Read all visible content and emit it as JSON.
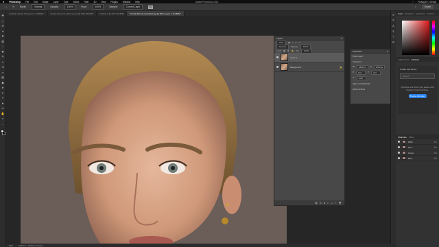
{
  "menubar": {
    "apple": "",
    "app_name": "Photoshop",
    "items": [
      "File",
      "Edit",
      "Image",
      "Layer",
      "Type",
      "Select",
      "Filter",
      "3D",
      "View",
      "Plugins",
      "Window",
      "Help"
    ],
    "window_title": "Adobe Photoshop 2022",
    "clock": "Fri Aug 19 7:19 AM"
  },
  "options": {
    "mode_label": "Mode:",
    "mode_value": "Normal",
    "opacity_label": "Opacity:",
    "opacity_value": "100%",
    "flow_label": "Flow:",
    "flow_value": "100%",
    "sample_label": "Sample:",
    "sample_value": "Current Layer",
    "share_label": "Share"
  },
  "tabs": [
    {
      "label": "Untitled-1 @ 66.7% (Layer 1, RGB/8) *",
      "active": false
    },
    {
      "label": "Model_Retouch_2022_v4.psd @ 50% (RGB/8)",
      "active": false
    },
    {
      "label": "Untitled-2 @ 25% (RGB/8)",
      "active": false
    },
    {
      "label": "Portrait-Blonde-Headshot.jpg @ 50% (Layer 1, RGB/8) *",
      "active": true
    }
  ],
  "tools": [
    "move",
    "marquee",
    "lasso",
    "magic-wand",
    "crop",
    "frame",
    "eyedropper",
    "healing",
    "brush",
    "clone-stamp",
    "history-brush",
    "eraser",
    "gradient",
    "blur",
    "dodge",
    "pen",
    "type",
    "path-select",
    "rectangle",
    "hand",
    "zoom",
    "more"
  ],
  "layers": {
    "title": "Layers",
    "kind_label": "Kind",
    "blend_value": "Normal",
    "opacity_label": "Opacity:",
    "opacity_value": "100%",
    "lock_label": "Lock:",
    "fill_label": "Fill:",
    "fill_value": "100%",
    "rows": [
      {
        "name": "Layer 1",
        "selected": true
      },
      {
        "name": "Background",
        "selected": false
      }
    ]
  },
  "properties": {
    "title": "Properties",
    "subtitle": "Pixel Layer",
    "transform_label": "Transform",
    "w_label": "W",
    "w_value": "1820 px",
    "h_label": "H",
    "h_value": "2730 px",
    "x_label": "X",
    "x_value": "0 px",
    "y_label": "Y",
    "y_value": "0 px",
    "angle_value": "0.00°",
    "align_label": "Align and Distribute",
    "quick_label": "Quick Actions"
  },
  "dock": {
    "tabs": [
      "Color",
      "Swatches",
      "Gradients",
      "Patterns"
    ],
    "adj_tabs": [
      "Adjustments",
      "Libraries"
    ],
    "create_label": "Create new library",
    "search_placeholder": "Search",
    "message": "Organize and share your assets with Creative Cloud Libraries.",
    "browse_label": "Browse Libraries",
    "channels_title": "Channels",
    "paths_title": "Paths",
    "channels": [
      {
        "name": "RGB",
        "key": "⌘2"
      },
      {
        "name": "Red",
        "key": "⌘3"
      },
      {
        "name": "Green",
        "key": "⌘4"
      },
      {
        "name": "Blue",
        "key": "⌘5"
      }
    ]
  },
  "status": {
    "zoom": "50%",
    "doc": "1820 px x 2730 px (72 ppi)"
  }
}
